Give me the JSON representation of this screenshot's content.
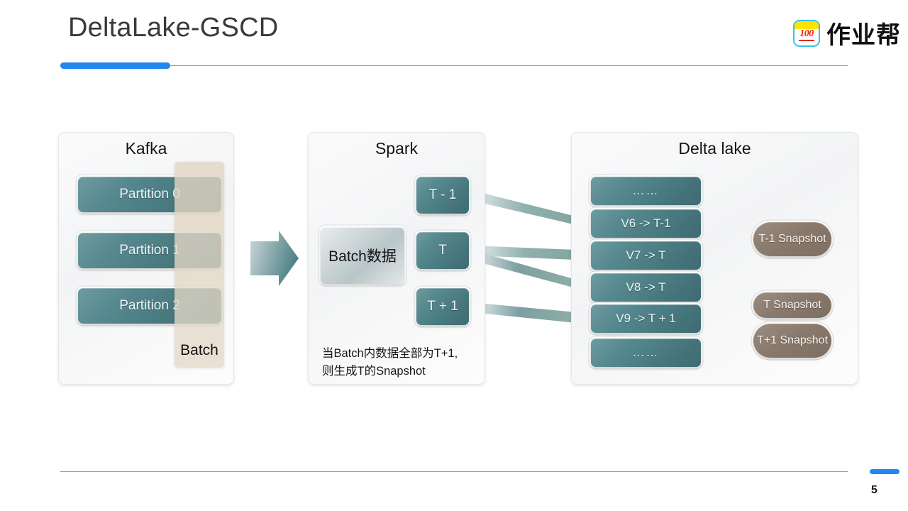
{
  "header": {
    "title": "DeltaLake-GSCD",
    "logo_text": "作业帮",
    "logo_number": "100"
  },
  "footer": {
    "page_number": "5"
  },
  "colors": {
    "accent_blue": "#2288ee",
    "teal_box": "#4a7c82",
    "snapshot_brown": "#897a6d",
    "batch_overlay": "#e2d6c4",
    "logo_yellow": "#ffe400",
    "logo_cyan": "#34c3ef",
    "logo_red": "#ee2200"
  },
  "panels": {
    "kafka": {
      "title": "Kafka",
      "partitions": [
        {
          "label": "Partition 0"
        },
        {
          "label": "Partition 1"
        },
        {
          "label": "Partition 2"
        }
      ],
      "batch_overlay_label": "Batch"
    },
    "spark": {
      "title": "Spark",
      "batch_box_label": "Batch数据",
      "time_boxes": [
        {
          "label": "T - 1"
        },
        {
          "label": "T"
        },
        {
          "label": "T + 1"
        }
      ],
      "caption_line_1": "当Batch内数据全部为T+1,",
      "caption_line_2": "则生成T的Snapshot"
    },
    "delta_lake": {
      "title": "Delta lake",
      "versions": [
        {
          "label": "……"
        },
        {
          "label": "V6 -> T-1"
        },
        {
          "label": "V7 -> T"
        },
        {
          "label": "V8 -> T"
        },
        {
          "label": "V9 -> T + 1"
        },
        {
          "label": "……"
        }
      ],
      "snapshots": [
        {
          "label": "T-1 Snapshot"
        },
        {
          "label": "T Snapshot"
        },
        {
          "label": "T+1 Snapshot"
        }
      ]
    }
  },
  "flow": {
    "kafka_to_spark_arrow": "arrow-right",
    "spark_to_delta_arrows": [
      {
        "from": "T - 1",
        "to": "V6 -> T-1"
      },
      {
        "from": "T",
        "to": "V7 -> T"
      },
      {
        "from": "T",
        "to": "V8 -> T"
      },
      {
        "from": "T + 1",
        "to": "V9 -> T + 1"
      }
    ],
    "delta_to_snapshot_arrows": [
      {
        "from": "V6 -> T-1",
        "to": "T-1 Snapshot"
      },
      {
        "from": "V8 -> T",
        "to": "T Snapshot"
      },
      {
        "from": "V9 -> T + 1",
        "to": "T+1 Snapshot"
      }
    ]
  }
}
